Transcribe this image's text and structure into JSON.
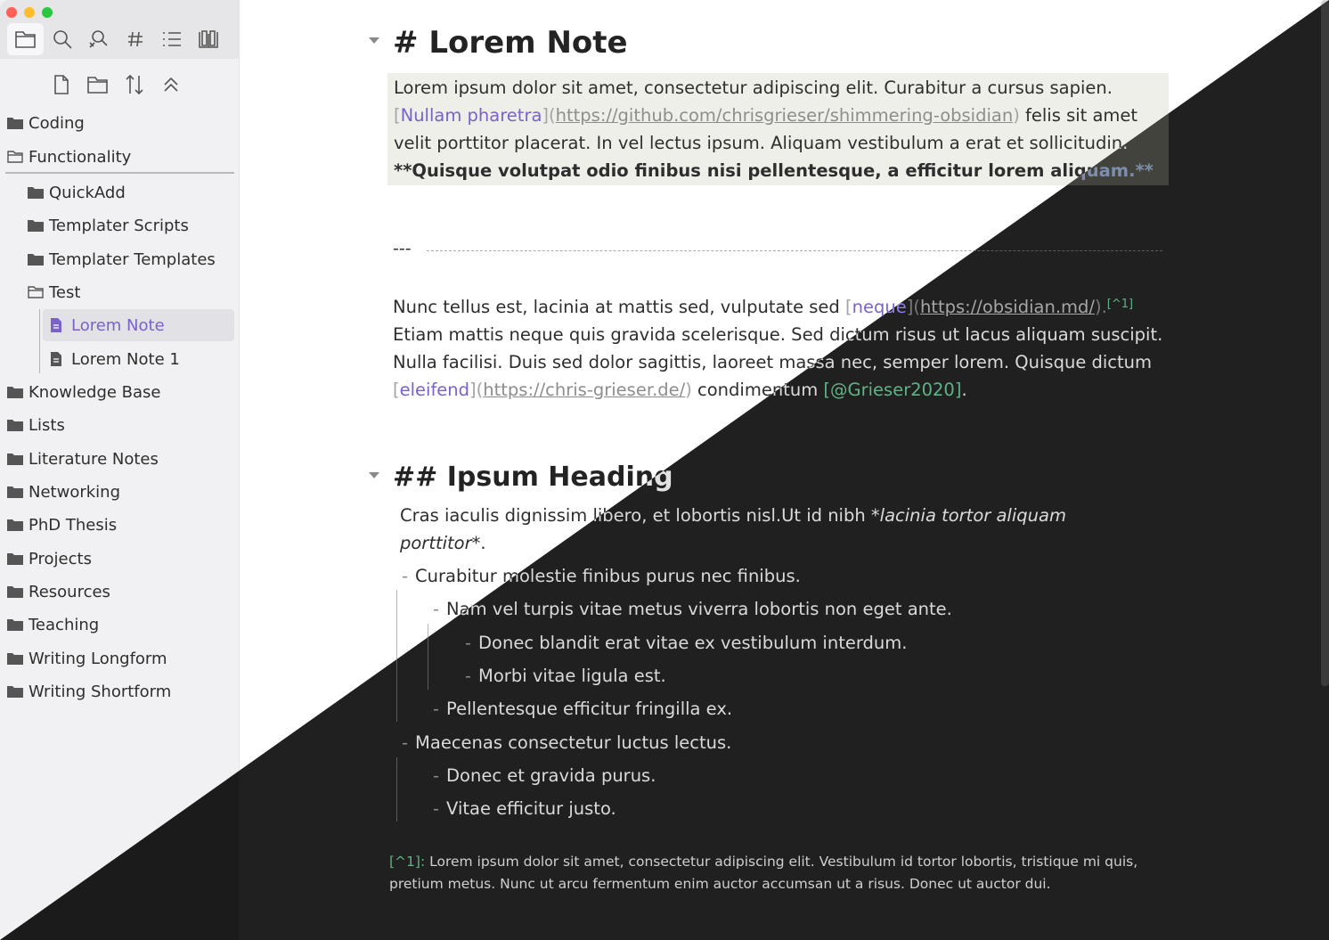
{
  "window": {
    "traffic_lights": [
      "close",
      "minimize",
      "zoom"
    ]
  },
  "sidebar": {
    "view_tabs": [
      "file-explorer-icon",
      "search-icon",
      "backlinks-icon",
      "tags-icon",
      "outline-icon",
      "bookmarks-icon"
    ],
    "actions": [
      "new-note-icon",
      "new-folder-icon",
      "sort-icon",
      "collapse-all-icon"
    ],
    "tree": {
      "coding": "Coding",
      "functionality": "Functionality",
      "quickadd": "QuickAdd",
      "templater_scripts": "Templater Scripts",
      "templater_templates": "Templater Templates",
      "test": "Test",
      "lorem_note": "Lorem Note",
      "lorem_note_1": "Lorem Note 1",
      "knowledge_base": "Knowledge Base",
      "lists": "Lists",
      "literature_notes": "Literature Notes",
      "networking": "Networking",
      "phd_thesis": "PhD Thesis",
      "projects": "Projects",
      "resources": "Resources",
      "teaching": "Teaching",
      "writing_longform": "Writing Longform",
      "writing_shortform": "Writing Shortform"
    }
  },
  "editor": {
    "h1": "# Lorem Note",
    "p1": {
      "t1": "Lorem ipsum dolor sit amet, consectetur adipiscing elit. Curabitur a cursus sapien. ",
      "link_text": "Nullam pharetra",
      "link_url": "https://github.com/chrisgrieser/shimmering-obsidian",
      "t2": " felis sit amet velit porttitor placerat. In vel lectus ipsum. Aliquam vestibulum a erat et sollicitudin. ",
      "bold": "**Quisque volutpat odio finibus nisi pellentesque, a efficitur lorem aliquam.**"
    },
    "hr": "---",
    "p2": {
      "t1": "Nunc tellus est, lacinia at mattis sed, vulputate sed ",
      "link1_text": "neque",
      "link1_url": "https://obsidian.md/",
      "footnote_ref": "[^1]",
      "t2": " Etiam mattis neque quis gravida scelerisque. Sed dictum risus ut lacus aliquam suscipit. Nulla facilisi. Duis sed dolor sagittis, laoreet massa nec, semper lorem. Quisque dictum ",
      "link2_text": "eleifend",
      "link2_url": "https://chris-grieser.de/",
      "t3": " condimentum ",
      "citation": "[@Grieser2020]",
      "t4": "."
    },
    "h2": "## Ipsum Heading",
    "p3": {
      "t1": "Cras iaculis dignissim libero, et lobortis nisl.Ut id nibh ",
      "italic": "*lacinia tortor aliquam porttitor*",
      "t2": "."
    },
    "list": {
      "dash": "-",
      "i1": "Curabitur molestie finibus purus nec finibus.",
      "i1a": "Nam vel turpis vitae metus viverra lobortis non eget ante.",
      "i1a1": "Donec blandit erat vitae ex vestibulum interdum.",
      "i1a2": "Morbi vitae ligula est.",
      "i1b": "Pellentesque efficitur fringilla ex.",
      "i2": "Maecenas consectetur luctus lectus.",
      "i2a": "Donec et gravida purus.",
      "i2b": "Vitae efficitur justo."
    },
    "footnote": {
      "label": "[^1]:",
      "text": " Lorem ipsum dolor sit amet, consectetur adipiscing elit. Vestibulum id tortor lobortis, tristique mi quis, pretium metus. Nunc ut arcu fermentum enim auctor accumsan ut a risus. Donec ut auctor dui."
    }
  },
  "colors": {
    "accent": "#7a62c9",
    "citation": "#3f9a6d",
    "light_bg": "#ffffff",
    "dark_bg": "#202020",
    "sidebar_light": "#f1f1f3"
  }
}
